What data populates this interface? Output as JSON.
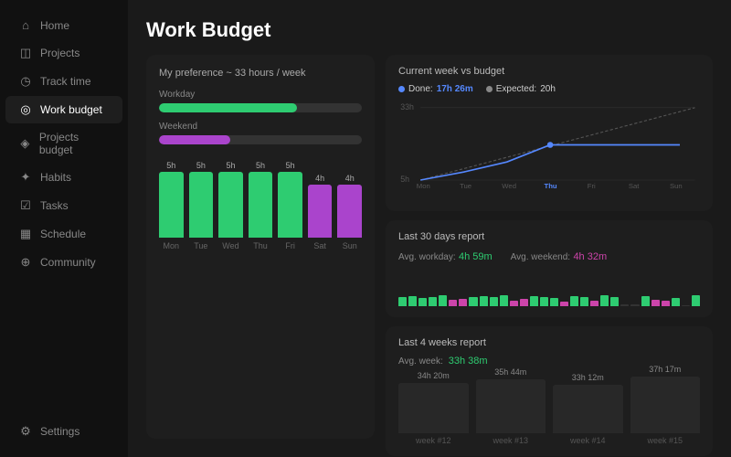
{
  "sidebar": {
    "items": [
      {
        "id": "home",
        "label": "Home",
        "icon": "⌂",
        "active": false
      },
      {
        "id": "projects",
        "label": "Projects",
        "icon": "◫",
        "active": false
      },
      {
        "id": "track-time",
        "label": "Track time",
        "icon": "◷",
        "active": false
      },
      {
        "id": "work-budget",
        "label": "Work budget",
        "icon": "◎",
        "active": true
      },
      {
        "id": "projects-budget",
        "label": "Projects budget",
        "icon": "◈",
        "active": false
      },
      {
        "id": "habits",
        "label": "Habits",
        "icon": "✦",
        "active": false
      },
      {
        "id": "tasks",
        "label": "Tasks",
        "icon": "☑",
        "active": false
      },
      {
        "id": "schedule",
        "label": "Schedule",
        "icon": "▦",
        "active": false
      },
      {
        "id": "community",
        "label": "Community",
        "icon": "⊕",
        "active": false
      }
    ],
    "bottom": [
      {
        "id": "settings",
        "label": "Settings",
        "icon": "⚙",
        "active": false
      }
    ]
  },
  "page": {
    "title": "Work Budget"
  },
  "preference_panel": {
    "title": "My preference ~ 33 hours / week",
    "workday_label": "Workday",
    "weekend_label": "Weekend",
    "workday_fill_pct": 68,
    "weekend_fill_pct": 35
  },
  "daily_chart": {
    "days": [
      {
        "name": "Mon",
        "hours": "5h",
        "height": 72,
        "color": "green"
      },
      {
        "name": "Tue",
        "hours": "5h",
        "height": 72,
        "color": "green"
      },
      {
        "name": "Wed",
        "hours": "5h",
        "height": 72,
        "color": "green"
      },
      {
        "name": "Thu",
        "hours": "5h",
        "height": 72,
        "color": "green"
      },
      {
        "name": "Fri",
        "hours": "5h",
        "height": 72,
        "color": "green"
      },
      {
        "name": "Sat",
        "hours": "4h",
        "height": 58,
        "color": "purple"
      },
      {
        "name": "Sun",
        "hours": "4h",
        "height": 58,
        "color": "purple"
      }
    ]
  },
  "current_week": {
    "title": "Current week vs budget",
    "legend": {
      "done_label": "Done:",
      "done_value": "17h 26m",
      "expected_label": "Expected:",
      "expected_value": "20h"
    },
    "y_labels": [
      "33h",
      "5h"
    ],
    "x_labels": [
      "Mon",
      "Tue",
      "Wed",
      "Thu",
      "Fri",
      "Sat",
      "Sun"
    ]
  },
  "last30": {
    "title": "Last 30 days report",
    "avg_workday_label": "Avg. workday:",
    "avg_workday_value": "4h 59m",
    "avg_weekend_label": "Avg. weekend:",
    "avg_weekend_value": "4h 32m",
    "bars": [
      {
        "c": "g",
        "h": 60
      },
      {
        "c": "g",
        "h": 70
      },
      {
        "c": "g",
        "h": 55
      },
      {
        "c": "g",
        "h": 65
      },
      {
        "c": "g",
        "h": 75
      },
      {
        "c": "p",
        "h": 45
      },
      {
        "c": "p",
        "h": 50
      },
      {
        "c": "g",
        "h": 65
      },
      {
        "c": "g",
        "h": 70
      },
      {
        "c": "g",
        "h": 60
      },
      {
        "c": "g",
        "h": 72
      },
      {
        "c": "p",
        "h": 40
      },
      {
        "c": "p",
        "h": 48
      },
      {
        "c": "g",
        "h": 68
      },
      {
        "c": "g",
        "h": 62
      },
      {
        "c": "g",
        "h": 55
      },
      {
        "c": "p",
        "h": 30
      },
      {
        "c": "g",
        "h": 70
      },
      {
        "c": "g",
        "h": 65
      },
      {
        "c": "p",
        "h": 35
      },
      {
        "c": "g",
        "h": 72
      },
      {
        "c": "g",
        "h": 60
      },
      {
        "c": "d",
        "h": 10
      },
      {
        "c": "d",
        "h": 15
      },
      {
        "c": "g",
        "h": 68
      },
      {
        "c": "p",
        "h": 42
      },
      {
        "c": "p",
        "h": 38
      },
      {
        "c": "g",
        "h": 55
      },
      {
        "c": "d",
        "h": 5
      },
      {
        "c": "g",
        "h": 72
      }
    ]
  },
  "last4weeks": {
    "title": "Last 4 weeks report",
    "avg_label": "Avg. week:",
    "avg_value": "33h 38m",
    "weeks": [
      {
        "name": "week #12",
        "hours": "34h 20m",
        "pct": 88
      },
      {
        "name": "week #13",
        "hours": "35h 44m",
        "pct": 95
      },
      {
        "name": "week #14",
        "hours": "33h 12m",
        "pct": 85
      },
      {
        "name": "week #15",
        "hours": "37h 17m",
        "pct": 100
      }
    ]
  }
}
